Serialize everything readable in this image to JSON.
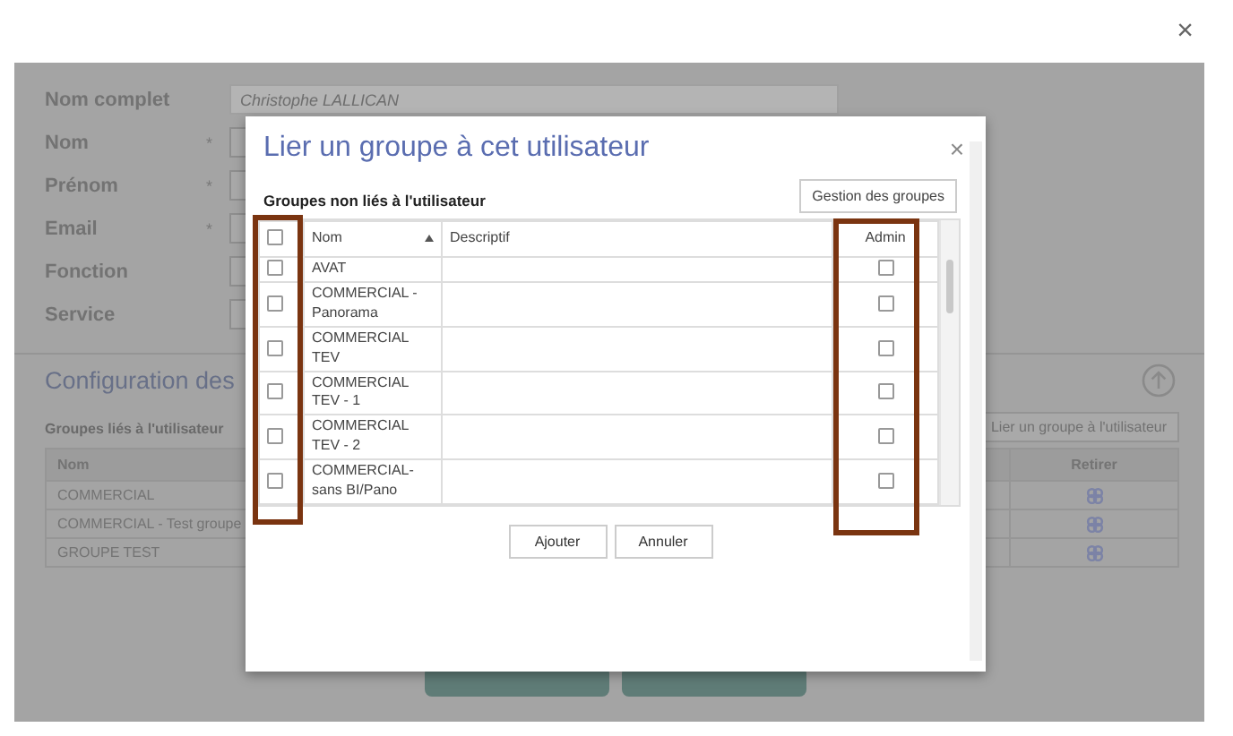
{
  "close_label": "×",
  "profile": {
    "fields": [
      {
        "label": "Nom complet",
        "required": false,
        "value": "Christophe LALLICAN",
        "readonly": true
      },
      {
        "label": "Nom",
        "required": true,
        "readonly": false
      },
      {
        "label": "Prénom",
        "required": true,
        "readonly": false
      },
      {
        "label": "Email",
        "required": true,
        "readonly": false
      },
      {
        "label": "Fonction",
        "required": false,
        "readonly": false
      },
      {
        "label": "Service",
        "required": false,
        "readonly": false
      }
    ],
    "required_mark": "*",
    "section_title": "Configuration des",
    "linked_title": "Groupes liés à l'utilisateur",
    "link_button": "Lier un groupe à l'utilisateur",
    "linked_columns": [
      "Nom",
      "Retirer"
    ],
    "linked_rows": [
      {
        "name": "COMMERCIAL"
      },
      {
        "name": "COMMERCIAL - Test groupe"
      },
      {
        "name": "GROUPE TEST"
      }
    ]
  },
  "dialog": {
    "title": "Lier un groupe à cet utilisateur",
    "close": "×",
    "subtitle": "Groupes non liés à l'utilisateur",
    "manage_button": "Gestion des groupes",
    "select_all": {
      "checked": false
    },
    "columns": [
      "Nom",
      "Descriptif",
      "Admin"
    ],
    "rows": [
      {
        "name": "AVAT",
        "checked": false,
        "admin": false
      },
      {
        "name": "COMMERCIAL - Panorama",
        "checked": false,
        "admin": false
      },
      {
        "name": "COMMERCIAL TEV",
        "checked": false,
        "admin": false
      },
      {
        "name": "COMMERCIAL TEV - 1",
        "checked": false,
        "admin": false
      },
      {
        "name": "COMMERCIAL TEV - 2",
        "checked": false,
        "admin": false
      },
      {
        "name": "COMMERCIAL- sans BI/Pano",
        "checked": false,
        "admin": false
      }
    ],
    "buttons": [
      "Ajouter",
      "Annuler"
    ]
  }
}
